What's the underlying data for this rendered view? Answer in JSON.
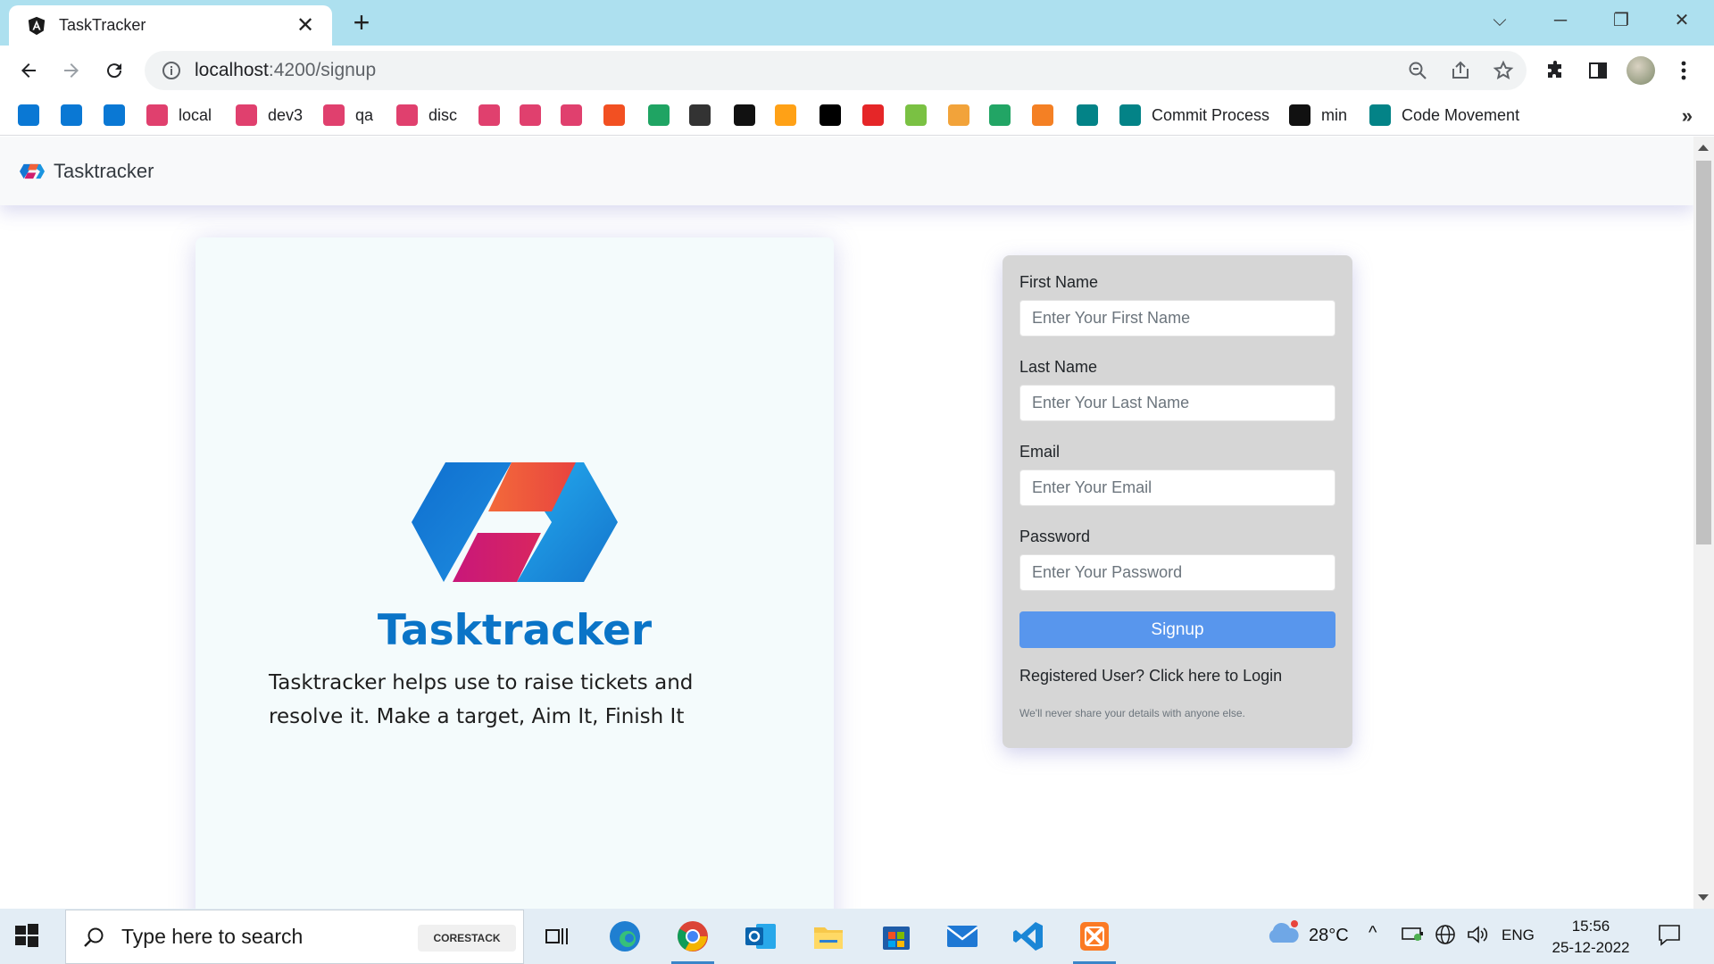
{
  "browser": {
    "tab_title": "TaskTracker",
    "url_host": "localhost",
    "url_path": ":4200/signup",
    "bookmarks": [
      {
        "label": "",
        "icon": "azure-devops-icon",
        "color": "#0a78d4"
      },
      {
        "label": "",
        "icon": "azure-devops-icon",
        "color": "#0a78d4"
      },
      {
        "label": "",
        "icon": "azure-devops-icon",
        "color": "#0a78d4"
      },
      {
        "label": "local",
        "icon": "tasktracker-icon",
        "color": "#e0406e"
      },
      {
        "label": "dev3",
        "icon": "tasktracker-icon",
        "color": "#e0406e"
      },
      {
        "label": "qa",
        "icon": "tasktracker-icon",
        "color": "#e0406e"
      },
      {
        "label": "disc",
        "icon": "tasktracker-icon",
        "color": "#e0406e"
      },
      {
        "label": "",
        "icon": "tasktracker-icon",
        "color": "#e0406e"
      },
      {
        "label": "",
        "icon": "tasktracker-icon",
        "color": "#e0406e"
      },
      {
        "label": "",
        "icon": "tasktracker-icon",
        "color": "#e0406e"
      },
      {
        "label": "",
        "icon": "microsoft-icon",
        "color": "#f25022"
      },
      {
        "label": "",
        "icon": "google-drive-icon",
        "color": "#1fa463"
      },
      {
        "label": "",
        "icon": "codechef-icon",
        "color": "#333333"
      },
      {
        "label": "",
        "icon": "angular-dev-icon",
        "color": "#111111"
      },
      {
        "label": "",
        "icon": "leetcode-icon",
        "color": "#ffa116"
      },
      {
        "label": "",
        "icon": "hackerrank-icon",
        "color": "#000000"
      },
      {
        "label": "",
        "icon": "tuf-icon",
        "color": "#e52628"
      },
      {
        "label": "",
        "icon": "b-circle-icon",
        "color": "#7ac143"
      },
      {
        "label": "",
        "icon": "gfg-like-icon",
        "color": "#f2a33a"
      },
      {
        "label": "",
        "icon": "sheets-icon",
        "color": "#22a565"
      },
      {
        "label": "",
        "icon": "stackoverflow-icon",
        "color": "#f48024"
      },
      {
        "label": "",
        "icon": "sharepoint-icon",
        "color": "#038387"
      },
      {
        "label": "Commit Process",
        "icon": "sharepoint-icon",
        "color": "#038387"
      },
      {
        "label": "min",
        "icon": "ff-icon",
        "color": "#111111"
      },
      {
        "label": "Code Movement",
        "icon": "sharepoint-icon",
        "color": "#038387"
      }
    ]
  },
  "app": {
    "brand": "Tasktracker",
    "hero_title": "Tasktracker",
    "hero_description": "Tasktracker helps use to raise tickets and resolve it. Make a target, Aim It, Finish It",
    "colors": {
      "accent": "#0a74c7",
      "button": "#5896ed",
      "form_bg": "#d6d6d6",
      "hero_bg": "#f4fbfc"
    }
  },
  "form": {
    "first_name": {
      "label": "First Name",
      "placeholder": "Enter Your First Name",
      "value": ""
    },
    "last_name": {
      "label": "Last Name",
      "placeholder": "Enter Your Last Name",
      "value": ""
    },
    "email": {
      "label": "Email",
      "placeholder": "Enter Your Email",
      "value": ""
    },
    "password": {
      "label": "Password",
      "placeholder": "Enter Your Password",
      "value": ""
    },
    "submit_label": "Signup",
    "login_link": "Registered User? Click here to Login",
    "privacy_note": "We'll never share your details with anyone else."
  },
  "taskbar": {
    "search_placeholder": "Type here to search",
    "search_badge": "CORESTACK",
    "weather": "28°C",
    "language": "ENG",
    "time": "15:56",
    "date": "25-12-2022"
  }
}
